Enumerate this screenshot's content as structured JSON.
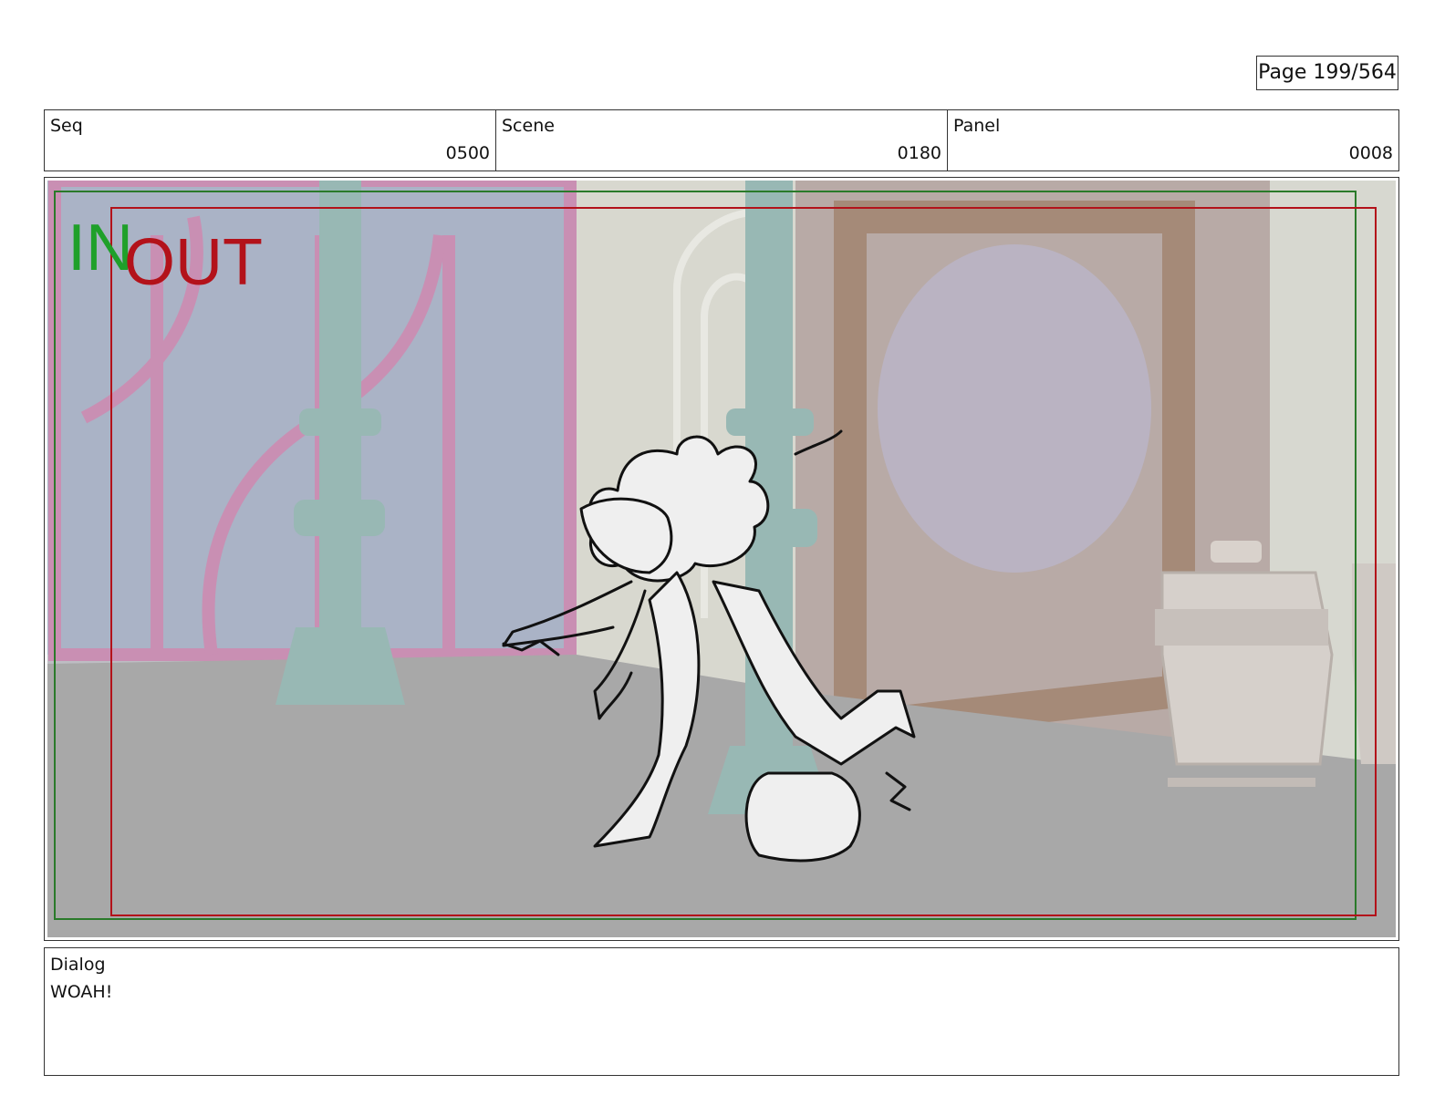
{
  "page": {
    "label": "Page 199/564"
  },
  "header": {
    "seq": {
      "label": "Seq",
      "value": "0500"
    },
    "scene": {
      "label": "Scene",
      "value": "0180"
    },
    "panel": {
      "label": "Panel",
      "value": "0008"
    }
  },
  "frame": {
    "in_label": "IN",
    "out_label": "OUT",
    "in_color": "#1fa02a",
    "out_color": "#b3121a"
  },
  "dialog": {
    "label": "Dialog",
    "text": "WOAH!"
  }
}
